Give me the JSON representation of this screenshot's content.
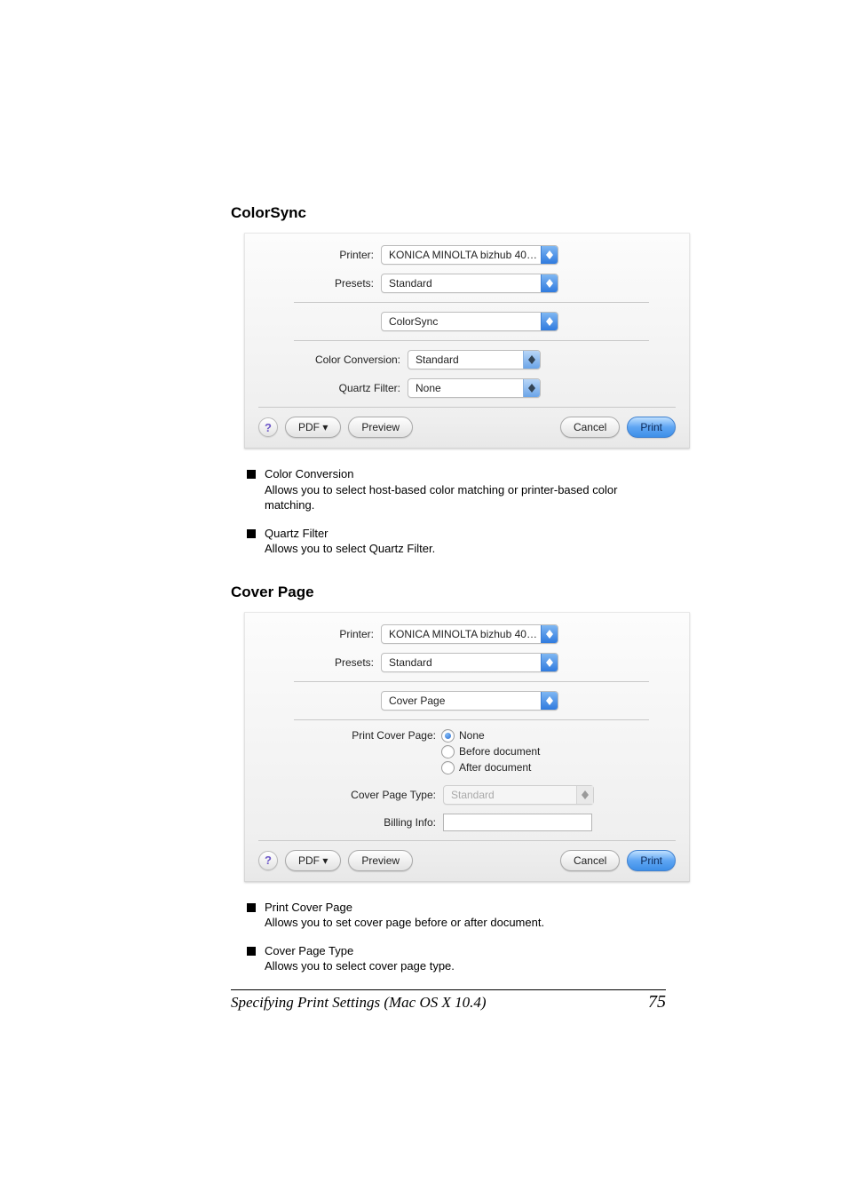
{
  "section_colorsync": {
    "title": "ColorSync",
    "printer_label": "Printer:",
    "presets_label": "Presets:",
    "category_value": "ColorSync",
    "printer_value": "KONICA MINOLTA bizhub 40P...",
    "presets_value": "Standard",
    "color_conversion_label": "Color Conversion:",
    "color_conversion_value": "Standard",
    "quartz_filter_label": "Quartz Filter:",
    "quartz_filter_value": "None",
    "help_glyph": "?",
    "pdf_btn": "PDF ▾",
    "preview_btn": "Preview",
    "cancel_btn": "Cancel",
    "print_btn": "Print",
    "bullets": [
      {
        "title": "Color Conversion",
        "desc": "Allows you to select host-based color matching or printer-based color matching."
      },
      {
        "title": "Quartz Filter",
        "desc": "Allows you to select Quartz Filter."
      }
    ]
  },
  "section_coverpage": {
    "title": "Cover Page",
    "printer_label": "Printer:",
    "presets_label": "Presets:",
    "printer_value": "KONICA MINOLTA bizhub 40P...",
    "presets_value": "Standard",
    "category_value": "Cover Page",
    "print_cover_page_label": "Print Cover Page:",
    "options": {
      "none": "None",
      "before": "Before document",
      "after": "After document"
    },
    "cover_page_type_label": "Cover Page Type:",
    "cover_page_type_value": "Standard",
    "billing_info_label": "Billing Info:",
    "billing_info_value": "",
    "help_glyph": "?",
    "pdf_btn": "PDF ▾",
    "preview_btn": "Preview",
    "cancel_btn": "Cancel",
    "print_btn": "Print",
    "bullets": [
      {
        "title": "Print Cover Page",
        "desc": "Allows you to set cover page before or after document."
      },
      {
        "title": "Cover Page Type",
        "desc": "Allows you to select cover page type."
      }
    ]
  },
  "footer": {
    "text": "Specifying Print Settings (Mac OS X 10.4)",
    "page": "75"
  }
}
